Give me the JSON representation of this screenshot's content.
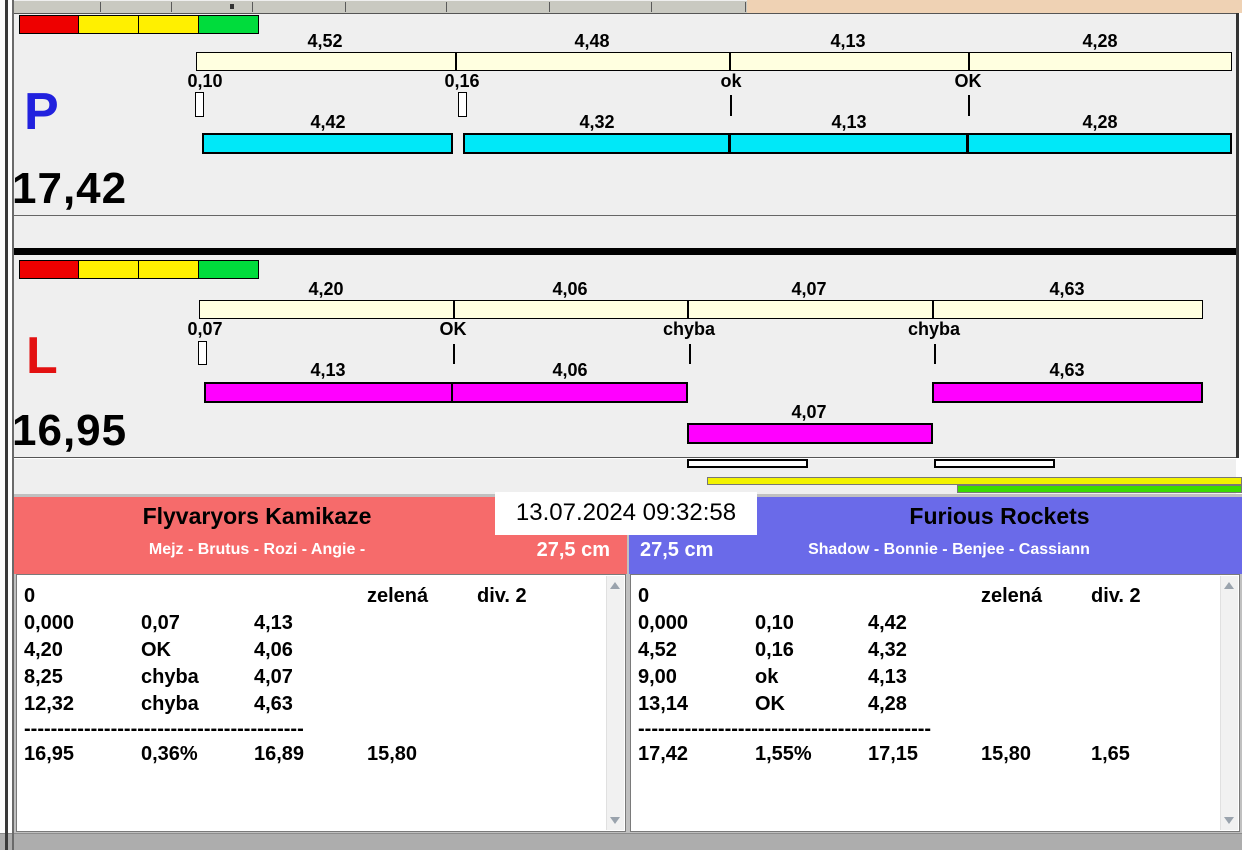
{
  "lane_p": {
    "label": "P",
    "total": "17,42",
    "splits_top": [
      "4,52",
      "4,48",
      "4,13",
      "4,28"
    ],
    "marks": [
      "0,10",
      "0,16",
      "ok",
      "OK"
    ],
    "splits_bottom": [
      "4,42",
      "4,32",
      "4,13",
      "4,28"
    ]
  },
  "lane_l": {
    "label": "L",
    "total": "16,95",
    "splits_top": [
      "4,20",
      "4,06",
      "4,07",
      "4,63"
    ],
    "marks": [
      "0,07",
      "OK",
      "chyba",
      "chyba"
    ],
    "splits_bottom": [
      "4,13",
      "4,06",
      "4,63"
    ],
    "rerun_split": "4,07"
  },
  "timestamp": "13.07.2024 09:32:58",
  "left_team": {
    "name": "Flyvaryors Kamikaze",
    "members": "Mejz - Brutus - Rozi - Angie -",
    "jump_height": "27,5 cm",
    "rows": [
      [
        "0",
        "",
        "",
        "zelená",
        "div. 2"
      ],
      [
        "0,000",
        "0,07",
        "4,13",
        "",
        ""
      ],
      [
        "4,20",
        "OK",
        "4,06",
        "",
        ""
      ],
      [
        "8,25",
        "chyba",
        "4,07",
        "",
        ""
      ],
      [
        "12,32",
        "chyba",
        "4,63",
        "",
        ""
      ]
    ],
    "separator": "------------------------------------------",
    "totals": [
      "16,95",
      "0,36%",
      "16,89",
      "15,80",
      ""
    ]
  },
  "right_team": {
    "name": "Furious Rockets",
    "members": "Shadow - Bonnie - Benjee - Cassiann",
    "jump_height": "27,5 cm",
    "rows": [
      [
        "0",
        "",
        "",
        "zelená",
        "div. 2"
      ],
      [
        "0,000",
        "0,10",
        "4,42",
        "",
        ""
      ],
      [
        "4,52",
        "0,16",
        "4,32",
        "",
        ""
      ],
      [
        "9,00",
        "ok",
        "4,13",
        "",
        ""
      ],
      [
        "13,14",
        "OK",
        "4,28",
        "",
        ""
      ]
    ],
    "separator": "--------------------------------------------",
    "totals": [
      "17,42",
      "1,55%",
      "17,15",
      "15,80",
      "1,65"
    ]
  },
  "colors": {
    "cream": "#FFFFE0",
    "cyan": "#00E8F8",
    "magenta": "#FF00FF",
    "signal_red": "#EE0000",
    "signal_yellow": "#FFF000",
    "signal_green": "#00DC3C",
    "red_header": "#F66B6B",
    "blue_header": "#6A6AE9",
    "tan_strip": "#EFD2B4"
  }
}
